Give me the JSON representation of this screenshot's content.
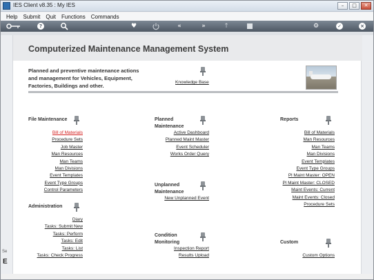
{
  "window": {
    "title": "IES Client v8.35 : My IES",
    "controls": [
      "–",
      "□",
      "✕"
    ]
  },
  "menu": [
    "Help",
    "Submit",
    "Quit",
    "Functions",
    "Commands"
  ],
  "toolbar": {
    "icons": [
      "key-icon",
      "help-icon",
      "search-icon",
      "heart-icon",
      "power-icon",
      "rewind-icon",
      "fast-forward-icon",
      "up-icon",
      "stop-icon",
      "gear-icon",
      "check-icon",
      "close-icon"
    ]
  },
  "page": {
    "title": "Computerized Maintenance Management System",
    "intro": [
      "Planned and preventive maintenance actions",
      "and management for Vehicles, Equipment,",
      "Factories, Buildings and other."
    ],
    "knowledge_base": "Knowledge Base"
  },
  "sections": {
    "file_maintenance": {
      "title": "File Maintenance",
      "links": [
        "Bill of Materials",
        "Procedure Sets",
        "Job Master",
        "Man Resources",
        "Man Teams",
        "Man Divisions",
        "Event Templates",
        "Event Type Groups",
        "Control Parameters"
      ]
    },
    "administration": {
      "title": "Administration",
      "links": [
        "Diary",
        "Tasks: Submit New",
        "Tasks: Perform",
        "Tasks: Edit",
        "Tasks: List",
        "Tasks: Check Progress"
      ]
    },
    "planned": {
      "title_line1": "Planned",
      "title_line2": "Maintenance",
      "links": [
        "Active Dashboard",
        "Planned Maint Master",
        "Event Scheduler",
        "Works Order Query"
      ]
    },
    "unplanned": {
      "title_line1": "Unplanned",
      "title_line2": "Maintenance",
      "links": [
        "New Unplanned Event"
      ]
    },
    "condition": {
      "title_line1": "Condition",
      "title_line2": "Monitoring",
      "links": [
        "Inspection Report",
        "Results Upload"
      ]
    },
    "reports": {
      "title": "Reports",
      "links": [
        "Bill of Materials",
        "Man Resources",
        "Man Teams",
        "Man Divisions",
        "Event Templates",
        "Event Type Groups",
        "Pl Maint Master: OPEN",
        "Pl Maint Master: CLOSED",
        "Maint Events: Current",
        "Maint Events: Closed",
        "Procedure Sets"
      ]
    },
    "custom": {
      "title": "Custom",
      "links": [
        "Custom Options"
      ]
    }
  },
  "status_fragment": "Se",
  "status_fragment2": "E"
}
